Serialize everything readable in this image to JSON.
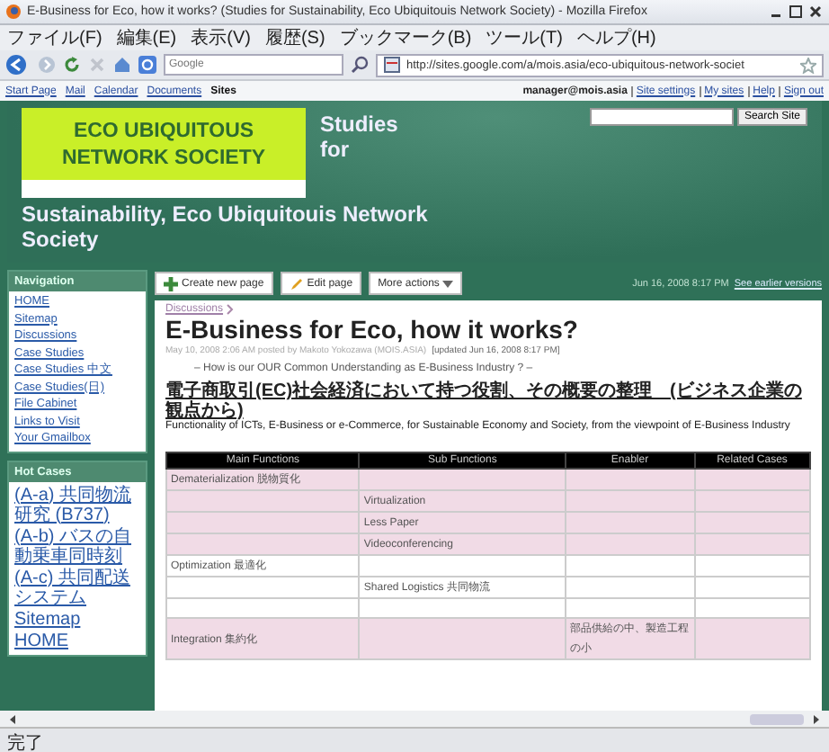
{
  "window": {
    "title": "E-Business for Eco, how it works? (Studies for Sustainability, Eco Ubiquitouis Network Society) - Mozilla Firefox"
  },
  "menu": [
    "ファイル(F)",
    "編集(E)",
    "表示(V)",
    "履歴(S)",
    "ブックマーク(B)",
    "ツール(T)",
    "ヘルプ(H)"
  ],
  "toolbar": {
    "search_placeholder": "Google",
    "url": "http://sites.google.com/a/mois.asia/eco-ubiquitous-network-societ"
  },
  "google_bar": {
    "links": [
      {
        "label": "Start Page",
        "current": false
      },
      {
        "label": "Mail",
        "current": false
      },
      {
        "label": "Calendar",
        "current": false
      },
      {
        "label": "Documents",
        "current": false
      },
      {
        "label": "Sites",
        "current": true
      }
    ],
    "user": "manager@mois.asia",
    "account_links": [
      "Site settings",
      "My sites",
      "Help",
      "Sign out"
    ]
  },
  "header": {
    "logo_lines": [
      "ECO UBIQUITOUS",
      "NETWORK SOCIETY"
    ],
    "site_title": [
      "Studies for",
      "Sustainability, Eco Ubiquitouis Network Society"
    ],
    "search_button": "Search Site"
  },
  "sidebar": [
    {
      "title": "Navigation",
      "items": [
        "HOME",
        "Sitemap",
        "Discussions",
        "Case Studies",
        "Case Studies 中文",
        "Case Studies(日)",
        "File Cabinet",
        "Links to Visit",
        "Your Gmailbox"
      ]
    },
    {
      "title": "Hot Cases",
      "items": [
        "(A-a) 共同物流研究 (B737)",
        "(A-b) バスの自動乗車同時刻",
        "(A-c) 共同配送システム",
        "Sitemap",
        "HOME"
      ]
    }
  ],
  "page_toolbar": {
    "buttons": [
      {
        "kind": "create",
        "label": "Create new page"
      },
      {
        "kind": "edit",
        "label": "Edit page"
      },
      {
        "kind": "menu",
        "label": "More actions"
      }
    ],
    "updated": "Jun 16, 2008 8:17 PM",
    "versions_link": "See earlier versions"
  },
  "page": {
    "breadcrumb": "Discussions",
    "title": "E-Business for Eco, how it works?",
    "meta": "May 10, 2008 2:06 AM posted by Makoto Yokozawa (MOIS.ASIA)",
    "updated": "[updated Jun 16, 2008 8:17 PM]",
    "question": "– How is our OUR Common Understanding as E-Business Industry ? –",
    "jp_heading": "電子商取引(EC)社会経済において持つ役割、その概要の整理　(ビジネス企業の観点から)",
    "paragraph": "Functionality of ICTs, E-Business or e-Commerce, for  Sustainable  Economy and Society, from the viewpoint of E-Business Industry"
  },
  "table": {
    "columns": [
      "Main Functions",
      "Sub Functions",
      "Enabler",
      "Related Cases"
    ],
    "rows": [
      {
        "shaded": true,
        "cells": [
          "Dematerialization 脱物質化",
          "",
          "",
          ""
        ]
      },
      {
        "shaded": true,
        "cells": [
          "",
          "Virtualization",
          "",
          ""
        ]
      },
      {
        "shaded": true,
        "cells": [
          "",
          "Less Paper",
          "",
          ""
        ]
      },
      {
        "shaded": true,
        "cells": [
          "",
          "Videoconferencing",
          "",
          ""
        ]
      },
      {
        "shaded": false,
        "cells": [
          "Optimization 最適化",
          "",
          "",
          ""
        ]
      },
      {
        "shaded": false,
        "cells": [
          "",
          "Shared Logistics  共同物流",
          "",
          ""
        ]
      },
      {
        "shaded": false,
        "cells": [
          "",
          "",
          "",
          ""
        ]
      },
      {
        "shaded": true,
        "cells": [
          "Integration  集約化",
          "",
          "部品供給の中、製造工程の小",
          ""
        ]
      }
    ]
  },
  "status_bar": "完了"
}
